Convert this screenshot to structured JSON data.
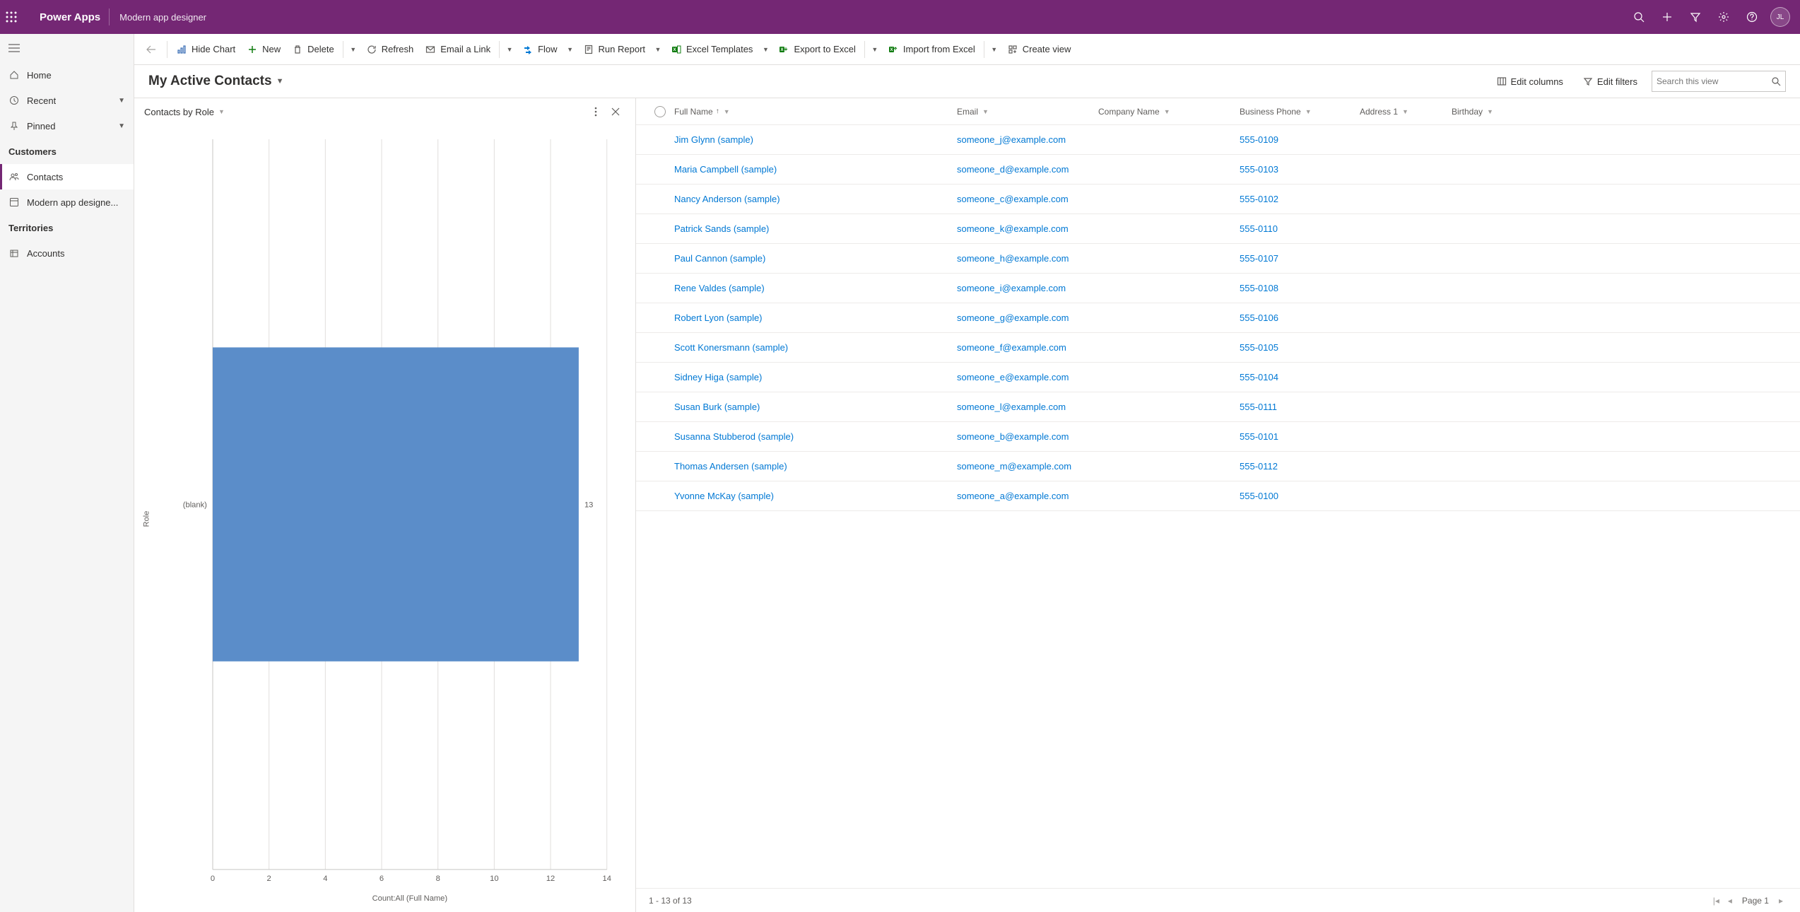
{
  "topbar": {
    "title": "Power Apps",
    "subtitle": "Modern app designer",
    "avatar_initials": "JL"
  },
  "leftnav": {
    "home": "Home",
    "recent": "Recent",
    "pinned": "Pinned",
    "group_customers": "Customers",
    "contacts": "Contacts",
    "modern_app": "Modern app designe...",
    "group_territories": "Territories",
    "accounts": "Accounts"
  },
  "commands": {
    "hide_chart": "Hide Chart",
    "new": "New",
    "delete": "Delete",
    "refresh": "Refresh",
    "email_link": "Email a Link",
    "flow": "Flow",
    "run_report": "Run Report",
    "excel_templates": "Excel Templates",
    "export_excel": "Export to Excel",
    "import_excel": "Import from Excel",
    "create_view": "Create view"
  },
  "view": {
    "title": "My Active Contacts",
    "edit_columns": "Edit columns",
    "edit_filters": "Edit filters",
    "search_placeholder": "Search this view"
  },
  "chart": {
    "title": "Contacts by Role",
    "ylabel": "Role",
    "xlabel": "Count:All (Full Name)"
  },
  "chart_data": {
    "type": "bar",
    "orientation": "horizontal",
    "categories": [
      "(blank)"
    ],
    "values": [
      13
    ],
    "xticks": [
      0,
      2,
      4,
      6,
      8,
      10,
      12,
      14
    ],
    "xlim": [
      0,
      14
    ],
    "xlabel": "Count:All (Full Name)",
    "ylabel": "Role",
    "title": "Contacts by Role"
  },
  "grid": {
    "columns": {
      "full_name": "Full Name",
      "email": "Email",
      "company": "Company Name",
      "phone": "Business Phone",
      "address": "Address 1",
      "birthday": "Birthday"
    },
    "rows": [
      {
        "name": "Jim Glynn (sample)",
        "email": "someone_j@example.com",
        "company": "",
        "phone": "555-0109",
        "address": "",
        "birthday": ""
      },
      {
        "name": "Maria Campbell (sample)",
        "email": "someone_d@example.com",
        "company": "",
        "phone": "555-0103",
        "address": "",
        "birthday": ""
      },
      {
        "name": "Nancy Anderson (sample)",
        "email": "someone_c@example.com",
        "company": "",
        "phone": "555-0102",
        "address": "",
        "birthday": ""
      },
      {
        "name": "Patrick Sands (sample)",
        "email": "someone_k@example.com",
        "company": "",
        "phone": "555-0110",
        "address": "",
        "birthday": ""
      },
      {
        "name": "Paul Cannon (sample)",
        "email": "someone_h@example.com",
        "company": "",
        "phone": "555-0107",
        "address": "",
        "birthday": ""
      },
      {
        "name": "Rene Valdes (sample)",
        "email": "someone_i@example.com",
        "company": "",
        "phone": "555-0108",
        "address": "",
        "birthday": ""
      },
      {
        "name": "Robert Lyon (sample)",
        "email": "someone_g@example.com",
        "company": "",
        "phone": "555-0106",
        "address": "",
        "birthday": ""
      },
      {
        "name": "Scott Konersmann (sample)",
        "email": "someone_f@example.com",
        "company": "",
        "phone": "555-0105",
        "address": "",
        "birthday": ""
      },
      {
        "name": "Sidney Higa (sample)",
        "email": "someone_e@example.com",
        "company": "",
        "phone": "555-0104",
        "address": "",
        "birthday": ""
      },
      {
        "name": "Susan Burk (sample)",
        "email": "someone_l@example.com",
        "company": "",
        "phone": "555-0111",
        "address": "",
        "birthday": ""
      },
      {
        "name": "Susanna Stubberod (sample)",
        "email": "someone_b@example.com",
        "company": "",
        "phone": "555-0101",
        "address": "",
        "birthday": ""
      },
      {
        "name": "Thomas Andersen (sample)",
        "email": "someone_m@example.com",
        "company": "",
        "phone": "555-0112",
        "address": "",
        "birthday": ""
      },
      {
        "name": "Yvonne McKay (sample)",
        "email": "someone_a@example.com",
        "company": "",
        "phone": "555-0100",
        "address": "",
        "birthday": ""
      }
    ],
    "footer": {
      "range": "1 - 13 of 13",
      "page": "Page 1"
    }
  }
}
